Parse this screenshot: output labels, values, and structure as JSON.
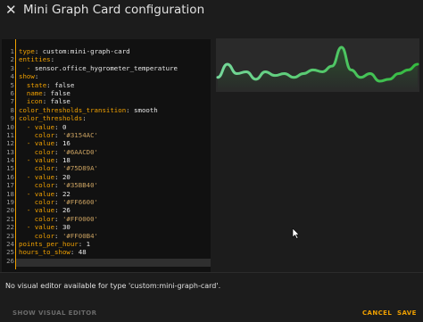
{
  "dialog": {
    "title": "Mini Graph Card configuration",
    "close_icon": "close-icon"
  },
  "editor": {
    "line_numbers": [
      "1",
      "2",
      "3",
      "4",
      "5",
      "6",
      "7",
      "8",
      "9",
      "10",
      "11",
      "12",
      "13",
      "14",
      "15",
      "16",
      "17",
      "18",
      "19",
      "20",
      "21",
      "22",
      "23",
      "24",
      "25",
      "26"
    ],
    "lines": [
      [
        {
          "t": "type",
          "c": "k"
        },
        {
          "t": ": ",
          "c": "v"
        },
        {
          "t": "custom:mini-graph-card",
          "c": "v"
        }
      ],
      [
        {
          "t": "entities",
          "c": "k"
        },
        {
          "t": ":",
          "c": "v"
        }
      ],
      [
        {
          "t": "  - ",
          "c": "dash"
        },
        {
          "t": "sensor.office_hygrometer_temperature",
          "c": "v"
        }
      ],
      [
        {
          "t": "show",
          "c": "k"
        },
        {
          "t": ":",
          "c": "v"
        }
      ],
      [
        {
          "t": "  state",
          "c": "k"
        },
        {
          "t": ": ",
          "c": "v"
        },
        {
          "t": "false",
          "c": "v"
        }
      ],
      [
        {
          "t": "  name",
          "c": "k"
        },
        {
          "t": ": ",
          "c": "v"
        },
        {
          "t": "false",
          "c": "v"
        }
      ],
      [
        {
          "t": "  icon",
          "c": "k"
        },
        {
          "t": ": ",
          "c": "v"
        },
        {
          "t": "false",
          "c": "v"
        }
      ],
      [
        {
          "t": "color_thresholds_transition",
          "c": "k"
        },
        {
          "t": ": ",
          "c": "v"
        },
        {
          "t": "smooth",
          "c": "v"
        }
      ],
      [
        {
          "t": "color_thresholds",
          "c": "k"
        },
        {
          "t": ":",
          "c": "v"
        }
      ],
      [
        {
          "t": "  - ",
          "c": "dash"
        },
        {
          "t": "value",
          "c": "k"
        },
        {
          "t": ": ",
          "c": "v"
        },
        {
          "t": "0",
          "c": "v"
        }
      ],
      [
        {
          "t": "    color",
          "c": "k"
        },
        {
          "t": ": ",
          "c": "v"
        },
        {
          "t": "'#3154AC'",
          "c": "s"
        }
      ],
      [
        {
          "t": "  - ",
          "c": "dash"
        },
        {
          "t": "value",
          "c": "k"
        },
        {
          "t": ": ",
          "c": "v"
        },
        {
          "t": "16",
          "c": "v"
        }
      ],
      [
        {
          "t": "    color",
          "c": "k"
        },
        {
          "t": ": ",
          "c": "v"
        },
        {
          "t": "'#6AACD0'",
          "c": "s"
        }
      ],
      [
        {
          "t": "  - ",
          "c": "dash"
        },
        {
          "t": "value",
          "c": "k"
        },
        {
          "t": ": ",
          "c": "v"
        },
        {
          "t": "18",
          "c": "v"
        }
      ],
      [
        {
          "t": "    color",
          "c": "k"
        },
        {
          "t": ": ",
          "c": "v"
        },
        {
          "t": "'#75D89A'",
          "c": "s"
        }
      ],
      [
        {
          "t": "  - ",
          "c": "dash"
        },
        {
          "t": "value",
          "c": "k"
        },
        {
          "t": ": ",
          "c": "v"
        },
        {
          "t": "20",
          "c": "v"
        }
      ],
      [
        {
          "t": "    color",
          "c": "k"
        },
        {
          "t": ": ",
          "c": "v"
        },
        {
          "t": "'#35BB40'",
          "c": "s"
        }
      ],
      [
        {
          "t": "  - ",
          "c": "dash"
        },
        {
          "t": "value",
          "c": "k"
        },
        {
          "t": ": ",
          "c": "v"
        },
        {
          "t": "22",
          "c": "v"
        }
      ],
      [
        {
          "t": "    color",
          "c": "k"
        },
        {
          "t": ": ",
          "c": "v"
        },
        {
          "t": "'#FF6600'",
          "c": "s"
        }
      ],
      [
        {
          "t": "  - ",
          "c": "dash"
        },
        {
          "t": "value",
          "c": "k"
        },
        {
          "t": ": ",
          "c": "v"
        },
        {
          "t": "26",
          "c": "v"
        }
      ],
      [
        {
          "t": "    color",
          "c": "k"
        },
        {
          "t": ": ",
          "c": "v"
        },
        {
          "t": "'#FF0000'",
          "c": "s"
        }
      ],
      [
        {
          "t": "  - ",
          "c": "dash"
        },
        {
          "t": "value",
          "c": "k"
        },
        {
          "t": ": ",
          "c": "v"
        },
        {
          "t": "30",
          "c": "v"
        }
      ],
      [
        {
          "t": "    color",
          "c": "k"
        },
        {
          "t": ": ",
          "c": "v"
        },
        {
          "t": "'#FF00B4'",
          "c": "s"
        }
      ],
      [
        {
          "t": "points_per_hour",
          "c": "k"
        },
        {
          "t": ": ",
          "c": "v"
        },
        {
          "t": "1",
          "c": "v"
        }
      ],
      [
        {
          "t": "hours_to_show",
          "c": "k"
        },
        {
          "t": ": ",
          "c": "v"
        },
        {
          "t": "48",
          "c": "v"
        }
      ],
      [
        {
          "t": "",
          "c": "v"
        }
      ]
    ]
  },
  "preview": {
    "sparkline_values": [
      10,
      17,
      12,
      13,
      9,
      13,
      11,
      12,
      10,
      12,
      14,
      13,
      16,
      26,
      14,
      10,
      12,
      8,
      9,
      12,
      14,
      17
    ],
    "line_color_start": "#75D89A",
    "line_color_end": "#35BB40"
  },
  "message": "No visual editor available for type 'custom:mini-graph-card'.",
  "footer": {
    "show_visual_editor": "SHOW VISUAL EDITOR",
    "cancel": "CANCEL",
    "save": "SAVE"
  },
  "colors": {
    "accent": "#f0a000",
    "background": "#1c1c1c",
    "editor_background": "#111111"
  }
}
